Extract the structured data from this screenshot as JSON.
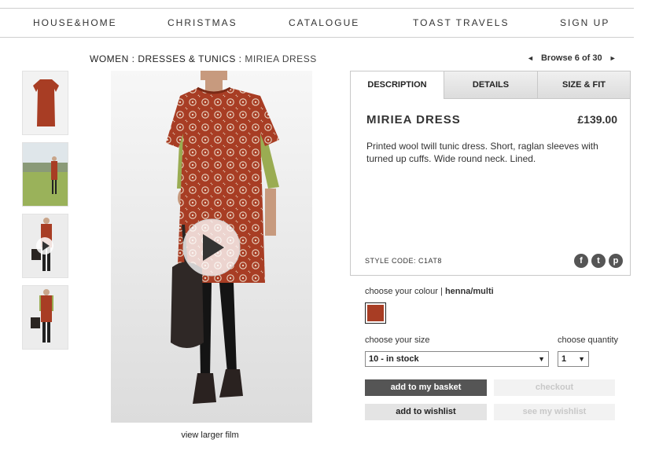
{
  "nav": {
    "items": [
      "HOUSE&HOME",
      "CHRISTMAS",
      "CATALOGUE",
      "TOAST TRAVELS",
      "SIGN UP"
    ]
  },
  "breadcrumb": {
    "women": "WOMEN",
    "sep": " : ",
    "category": "DRESSES & TUNICS",
    "current": "MIRIEA DRESS"
  },
  "browse": {
    "prev": "◄",
    "label": "Browse 6 of 30",
    "next": "►"
  },
  "gallery": {
    "play_icon": "play-icon",
    "view_larger": "view larger film"
  },
  "tabs": [
    "DESCRIPTION",
    "DETAILS",
    "SIZE & FIT"
  ],
  "product": {
    "name": "MIRIEA DRESS",
    "price": "£139.00",
    "description": "Printed wool twill tunic dress. Short, raglan sleeves with turned up cuffs. Wide round neck. Lined.",
    "style_code": "STYLE CODE: C1AT8"
  },
  "social": [
    {
      "name": "facebook-icon",
      "glyph": "f"
    },
    {
      "name": "twitter-icon",
      "glyph": "t"
    },
    {
      "name": "pinterest-icon",
      "glyph": "p"
    }
  ],
  "colour": {
    "label": "choose your colour",
    "separator": " | ",
    "value": "henna/multi",
    "swatch_color": "#a83d24"
  },
  "size": {
    "label": "choose your size",
    "selected": "10 - in stock"
  },
  "quantity": {
    "label": "choose quantity",
    "selected": "1"
  },
  "buttons": {
    "add_basket": "add to my basket",
    "checkout": "checkout",
    "add_wishlist": "add to wishlist",
    "see_wishlist": "see my wishlist"
  },
  "colors": {
    "dress": "#a83d24",
    "sleeve": "#9aac52",
    "dark_button": "#555555"
  }
}
